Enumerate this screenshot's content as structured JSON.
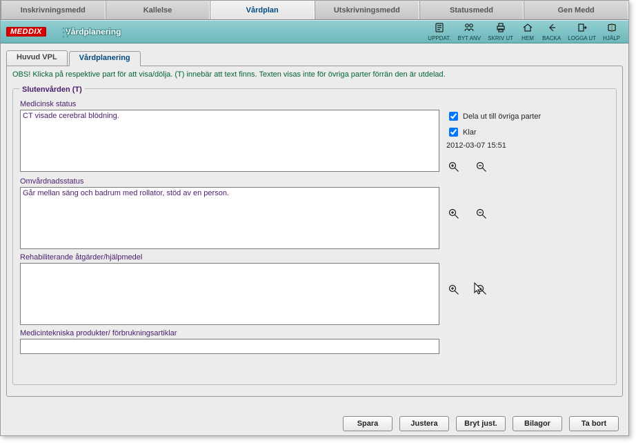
{
  "topTabs": {
    "items": [
      "Inskrivningsmedd",
      "Kallelse",
      "Vårdplan",
      "Utskrivningsmedd",
      "Statusmedd",
      "Gen Medd"
    ],
    "activeIndex": 2
  },
  "titleBar": {
    "logo": "MEDDIX",
    "title": "Vårdplanering"
  },
  "toolbar": {
    "items": [
      {
        "label": "UPPDAT.",
        "icon": "refresh-icon"
      },
      {
        "label": "BYT ANV",
        "icon": "switch-user-icon"
      },
      {
        "label": "SKRIV UT",
        "icon": "print-icon"
      },
      {
        "label": "HEM",
        "icon": "home-icon"
      },
      {
        "label": "BACKA",
        "icon": "back-icon"
      },
      {
        "label": "LOGGA UT",
        "icon": "logout-icon"
      },
      {
        "label": "HJÄLP",
        "icon": "help-icon"
      }
    ]
  },
  "subTabs": {
    "items": [
      "Huvud VPL",
      "Vårdplanering"
    ],
    "activeIndex": 1
  },
  "hint": "OBS! Klicka på respektive part för att visa/dölja. (T) innebär att text finns. Texten visas inte för övriga parter förrän den är utdelad.",
  "groupTitle": "Slutenvården (T)",
  "sections": {
    "medStatus": {
      "label": "Medicinsk status",
      "value": "CT visade cerebral blödning.",
      "distribute": true,
      "done": true,
      "timestamp": "2012-03-07 15:51"
    },
    "omvard": {
      "label": "Omvårdnadsstatus",
      "value": "Går mellan säng och badrum med rollator, stöd av en person."
    },
    "rehab": {
      "label": "Rehabiliterande åtgärder/hjälpmedel",
      "value": ""
    },
    "medtek": {
      "label": "Medicintekniska produkter/ förbrukningsartiklar",
      "value": ""
    }
  },
  "checkLabels": {
    "distribute": "Dela ut till övriga parter",
    "done": "Klar"
  },
  "buttons": {
    "save": "Spara",
    "adjust": "Justera",
    "breakAdjust": "Bryt just.",
    "attachments": "Bilagor",
    "delete": "Ta bort"
  }
}
